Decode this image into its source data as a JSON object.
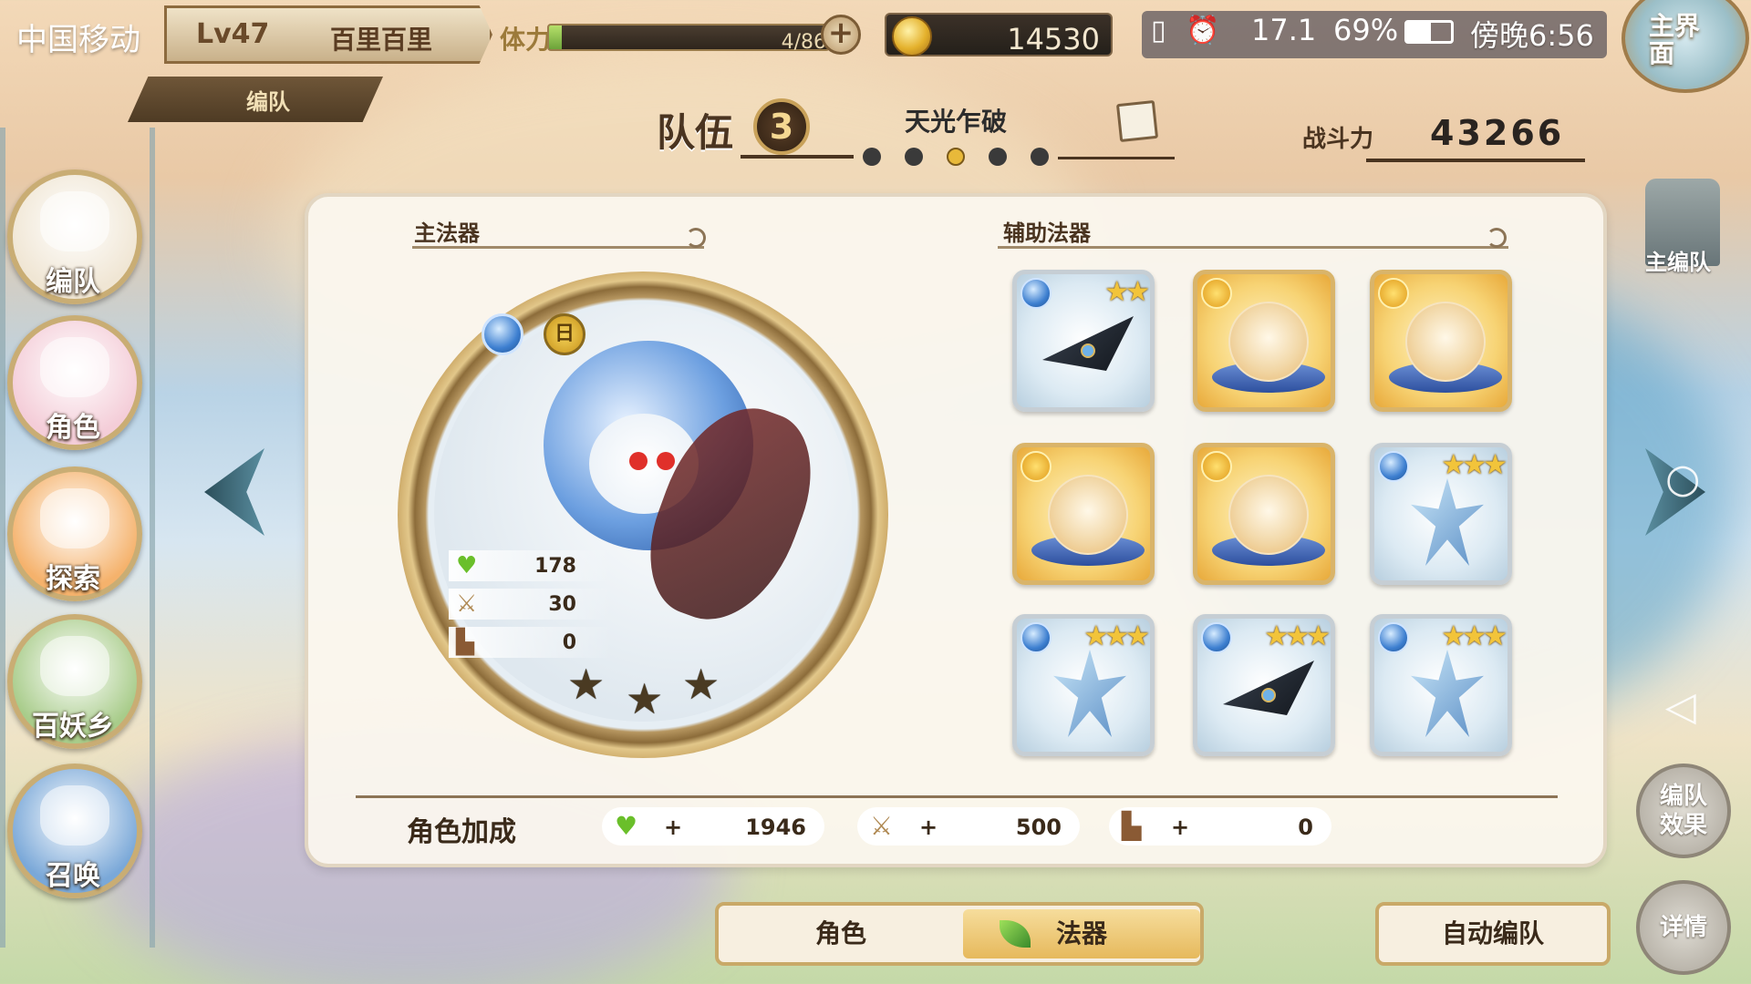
{
  "status_bar": {
    "carrier": "中国移动",
    "player_level": "Lv47",
    "player_name": "百里百里",
    "stamina_label": "体力",
    "stamina_text": "4/86",
    "stamina_fraction": 0.047,
    "plus_symbol": "+",
    "gold": "14530",
    "signal": "17.1",
    "battery": "69%",
    "time": "傍晚6:56"
  },
  "home_button": {
    "label": "主界面"
  },
  "page_tab": {
    "label": "编队"
  },
  "left_nav": [
    {
      "label": "编队",
      "icon": "formation-icon",
      "color": "#f0e6d4"
    },
    {
      "label": "角色",
      "icon": "character-icon",
      "color": "#f4cdd8"
    },
    {
      "label": "探索",
      "icon": "explore-icon",
      "color": "#f5b26c"
    },
    {
      "label": "百妖乡",
      "icon": "village-icon",
      "color": "#a8cc8a"
    },
    {
      "label": "召唤",
      "icon": "summon-icon",
      "color": "#7aa8d8"
    }
  ],
  "team": {
    "label": "队伍",
    "number": "3",
    "name": "天光乍破",
    "page_count": 5,
    "active_page": 3,
    "power_label": "战斗力",
    "power_value": "43266"
  },
  "main_artifact": {
    "section_title": "主法器",
    "element": "water-element-icon",
    "day_badge": "日",
    "hp": "178",
    "attack": "30",
    "speed": "0",
    "stars": 3
  },
  "sub_artifacts": {
    "section_title": "辅助法器",
    "items": [
      {
        "name": "dark-blade-artifact",
        "element": "water",
        "frame": "blue",
        "stars": 2,
        "art": "blade"
      },
      {
        "name": "fire-bowl-artifact",
        "element": "fire",
        "frame": "gold",
        "stars": 0,
        "art": "bowl"
      },
      {
        "name": "fire-bowl-artifact",
        "element": "fire",
        "frame": "gold",
        "stars": 0,
        "art": "bowl"
      },
      {
        "name": "fire-bowl-artifact",
        "element": "fire",
        "frame": "gold",
        "stars": 0,
        "art": "bowl"
      },
      {
        "name": "fire-bowl-artifact",
        "element": "fire",
        "frame": "gold",
        "stars": 0,
        "art": "bowl"
      },
      {
        "name": "coral-artifact",
        "element": "water",
        "frame": "blue",
        "stars": 3,
        "art": "coral"
      },
      {
        "name": "coral-artifact",
        "element": "water",
        "frame": "blue",
        "stars": 3,
        "art": "coral"
      },
      {
        "name": "dark-blade-artifact",
        "element": "water",
        "frame": "blue",
        "stars": 3,
        "art": "blade"
      },
      {
        "name": "coral-artifact",
        "element": "water",
        "frame": "blue",
        "stars": 3,
        "art": "coral"
      }
    ]
  },
  "bonus": {
    "label": "角色加成",
    "hp": "1946",
    "attack": "500",
    "speed": "0",
    "plus": "+"
  },
  "bottom_tabs": {
    "character": "角色",
    "artifact": "法器",
    "active": "artifact"
  },
  "auto_button": {
    "label": "自动编队"
  },
  "right_panel": {
    "main_team_label": "主编队",
    "formation_effect_label": "编队效果",
    "detail_label": "详情"
  }
}
